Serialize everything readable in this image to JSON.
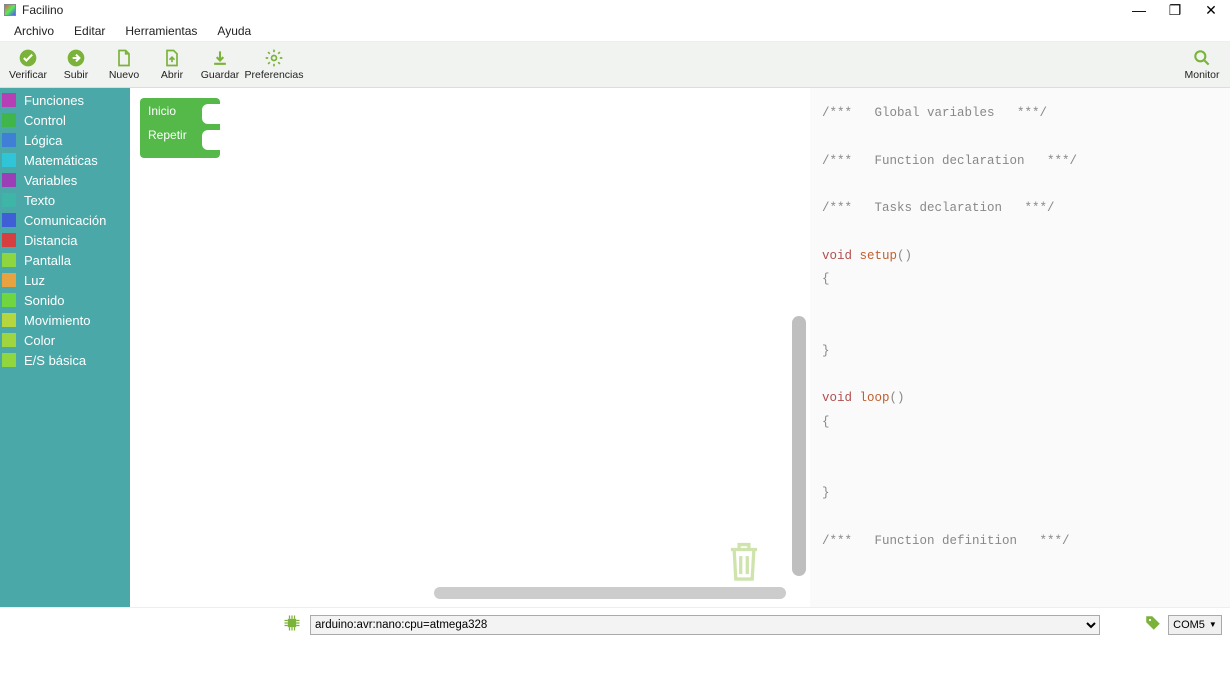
{
  "window": {
    "title": "Facilino"
  },
  "menu": {
    "archivo": "Archivo",
    "editar": "Editar",
    "herramientas": "Herramientas",
    "ayuda": "Ayuda"
  },
  "toolbar": {
    "verificar": "Verificar",
    "subir": "Subir",
    "nuevo": "Nuevo",
    "abrir": "Abrir",
    "guardar": "Guardar",
    "preferencias": "Preferencias",
    "monitor": "Monitor"
  },
  "categories": [
    {
      "label": "Funciones",
      "color": "#b53fb5"
    },
    {
      "label": "Control",
      "color": "#3fb54a"
    },
    {
      "label": "Lógica",
      "color": "#3f7fd6"
    },
    {
      "label": "Matemáticas",
      "color": "#2fc5d6"
    },
    {
      "label": "Variables",
      "color": "#9a3fb5"
    },
    {
      "label": "Texto",
      "color": "#3fb5a8"
    },
    {
      "label": "Comunicación",
      "color": "#3f5fd6"
    },
    {
      "label": "Distancia",
      "color": "#d63f3f"
    },
    {
      "label": "Pantalla",
      "color": "#8ed63f"
    },
    {
      "label": "Luz",
      "color": "#e8a23f"
    },
    {
      "label": "Sonido",
      "color": "#6fd63f"
    },
    {
      "label": "Movimiento",
      "color": "#b5d63f"
    },
    {
      "label": "Color",
      "color": "#9fd63f"
    },
    {
      "label": "E/S básica",
      "color": "#8fd63f"
    }
  ],
  "block": {
    "inicio": "Inicio",
    "repetir": "Repetir"
  },
  "code": {
    "c1": "/***   Global variables   ***/",
    "c2": "/***   Function declaration   ***/",
    "c3": "/***   Tasks declaration   ***/",
    "kw_void1": "void",
    "fn_setup": "setup",
    "paren1": "()",
    "brace_o1": "{",
    "brace_c1": "}",
    "kw_void2": "void",
    "fn_loop": "loop",
    "paren2": "()",
    "brace_o2": "{",
    "brace_c2": "}",
    "c4": "/***   Function definition   ***/"
  },
  "status": {
    "board": "arduino:avr:nano:cpu=atmega328",
    "port": "COM5"
  }
}
